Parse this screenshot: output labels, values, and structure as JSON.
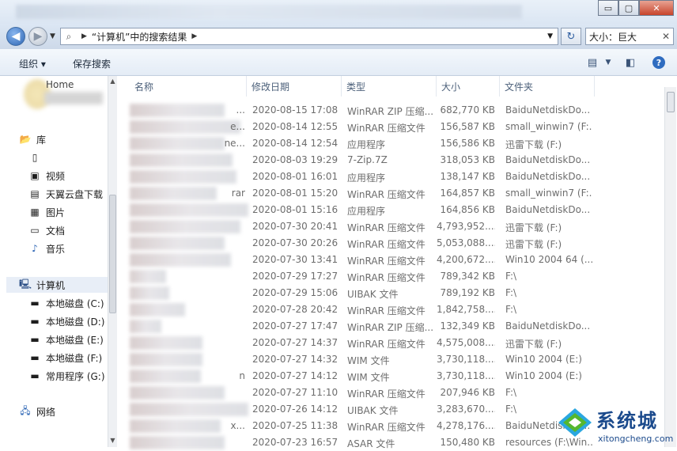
{
  "window": {
    "controls": {
      "minimize": "▭",
      "maximize": "▢",
      "close": "✕"
    }
  },
  "address": {
    "path": "“计算机”中的搜索结果",
    "search_value": "大小：巨大",
    "clear_symbol": "✕"
  },
  "toolbar": {
    "organize_label": "组织 ▾",
    "save_search_label": "保存搜索"
  },
  "sidebar": {
    "home_label": "Home",
    "library_label": "库",
    "items": [
      {
        "label": "视频",
        "icon": "video-icon"
      },
      {
        "label": "天翼云盘下载",
        "icon": "folder-download-icon"
      },
      {
        "label": "图片",
        "icon": "picture-icon"
      },
      {
        "label": "文档",
        "icon": "document-icon"
      },
      {
        "label": "音乐",
        "icon": "music-icon"
      }
    ],
    "computer_label": "计算机",
    "drives": [
      {
        "label": "本地磁盘 (C:)"
      },
      {
        "label": "本地磁盘 (D:)"
      },
      {
        "label": "本地磁盘 (E:)"
      },
      {
        "label": "本地磁盘 (F:)"
      },
      {
        "label": "常用程序 (G:)"
      }
    ],
    "network_label": "网络"
  },
  "columns": {
    "name": "名称",
    "date": "修改日期",
    "type": "类型",
    "size": "大小",
    "folder": "文件夹"
  },
  "files": [
    {
      "name_hint": "...",
      "date": "2020-08-15 17:08",
      "type": "WinRAR ZIP 压缩...",
      "size": "682,770 KB",
      "folder": "BaiduNetdiskDo..."
    },
    {
      "name_hint": "e...",
      "date": "2020-08-14 12:55",
      "type": "WinRAR 压缩文件",
      "size": "156,587 KB",
      "folder": "small_winwin7 (F:..."
    },
    {
      "name_hint": "ne...",
      "date": "2020-08-14 12:54",
      "type": "应用程序",
      "size": "156,586 KB",
      "folder": "迅雷下载 (F:)"
    },
    {
      "name_hint": "",
      "date": "2020-08-03 19:29",
      "type": "7-Zip.7Z",
      "size": "318,053 KB",
      "folder": "BaiduNetdiskDo..."
    },
    {
      "name_hint": "",
      "date": "2020-08-01 16:01",
      "type": "应用程序",
      "size": "138,147 KB",
      "folder": "BaiduNetdiskDo..."
    },
    {
      "name_hint": "rar",
      "date": "2020-08-01 15:20",
      "type": "WinRAR 压缩文件",
      "size": "164,857 KB",
      "folder": "small_winwin7 (F:..."
    },
    {
      "name_hint": "",
      "date": "2020-08-01 15:16",
      "type": "应用程序",
      "size": "164,856 KB",
      "folder": "BaiduNetdiskDo..."
    },
    {
      "name_hint": "",
      "date": "2020-07-30 20:41",
      "type": "WinRAR 压缩文件",
      "size": "4,793,952....",
      "folder": "迅雷下载 (F:)"
    },
    {
      "name_hint": "",
      "date": "2020-07-30 20:26",
      "type": "WinRAR 压缩文件",
      "size": "5,053,088....",
      "folder": "迅雷下载 (F:)"
    },
    {
      "name_hint": "",
      "date": "2020-07-30 13:41",
      "type": "WinRAR 压缩文件",
      "size": "4,200,672....",
      "folder": "Win10 2004 64 (..."
    },
    {
      "name_hint": "",
      "date": "2020-07-29 17:27",
      "type": "WinRAR 压缩文件",
      "size": "789,342 KB",
      "folder": "F:\\"
    },
    {
      "name_hint": "",
      "date": "2020-07-29 15:06",
      "type": "UIBAK 文件",
      "size": "789,192 KB",
      "folder": "F:\\"
    },
    {
      "name_hint": "",
      "date": "2020-07-28 20:42",
      "type": "WinRAR 压缩文件",
      "size": "1,842,758....",
      "folder": "F:\\"
    },
    {
      "name_hint": "",
      "date": "2020-07-27 17:47",
      "type": "WinRAR ZIP 压缩...",
      "size": "132,349 KB",
      "folder": "BaiduNetdiskDo..."
    },
    {
      "name_hint": "",
      "date": "2020-07-27 14:37",
      "type": "WinRAR 压缩文件",
      "size": "4,575,008....",
      "folder": "迅雷下载 (F:)"
    },
    {
      "name_hint": "",
      "date": "2020-07-27 14:32",
      "type": "WIM 文件",
      "size": "3,730,118....",
      "folder": "Win10 2004 (E:)"
    },
    {
      "name_hint": "n",
      "date": "2020-07-27 14:12",
      "type": "WIM 文件",
      "size": "3,730,118....",
      "folder": "Win10 2004 (E:)"
    },
    {
      "name_hint": "",
      "date": "2020-07-27 11:10",
      "type": "WinRAR 压缩文件",
      "size": "207,946 KB",
      "folder": "F:\\"
    },
    {
      "name_hint": "",
      "date": "2020-07-26 14:12",
      "type": "UIBAK 文件",
      "size": "3,283,670....",
      "folder": "F:\\"
    },
    {
      "name_hint": "x...",
      "date": "2020-07-25 11:38",
      "type": "WinRAR 压缩文件",
      "size": "4,278,176....",
      "folder": "BaiduNetdiskDo..."
    },
    {
      "name_hint": "",
      "date": "2020-07-23 16:57",
      "type": "ASAR 文件",
      "size": "150,480 KB",
      "folder": "resources (F:\\Win..."
    }
  ],
  "watermark": {
    "brand": "系统城",
    "url": "xitongcheng.com",
    "colors": {
      "blue": "#1b4a8c",
      "green": "#55b72f",
      "cyan": "#2aa7e0"
    }
  }
}
